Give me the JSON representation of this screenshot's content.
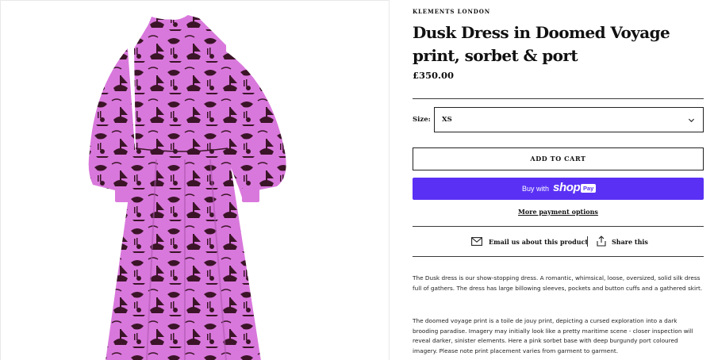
{
  "product": {
    "vendor": "KLEMENTS LONDON",
    "title": "Dusk Dress in Doomed Voyage print, sorbet & port",
    "price": "£350.00",
    "image_alt_icon": "product-photo-dress"
  },
  "size": {
    "label": "Size:",
    "selected": "XS",
    "icon": "chevron-down-icon"
  },
  "buttons": {
    "add_to_cart": "ADD TO CART",
    "shop_pay_prefix": "Buy with",
    "shop_pay_brand": "shop",
    "shop_pay_badge": "Pay",
    "more_payment": "More payment options"
  },
  "share": {
    "email_label": "Email us about this product",
    "share_label": "Share this",
    "email_icon": "envelope-icon",
    "share_icon": "share-icon"
  },
  "description": {
    "paragraph_1": "The Dusk dress is our show-stopping dress. A romantic, whimsical, loose, oversized, solid silk dress full of gathers. The dress has large billowing sleeves, pockets and  button cuffs and a gathered skirt.",
    "paragraph_2": "The doomed voyage print is a toile de jouy print, depicting a cursed exploration into a dark brooding paradise. Imagery may initially look like a pretty maritime scene - closer inspection will reveal darker, sinister elements. Here a pink sorbet base with deep burgundy port coloured imagery. Please note print placement varies from garment to garment."
  },
  "colors": {
    "dress_base": "#d978dc",
    "dress_print": "#3b1428",
    "shop_pay": "#5a31f4",
    "rule": "#3a3a3a"
  }
}
